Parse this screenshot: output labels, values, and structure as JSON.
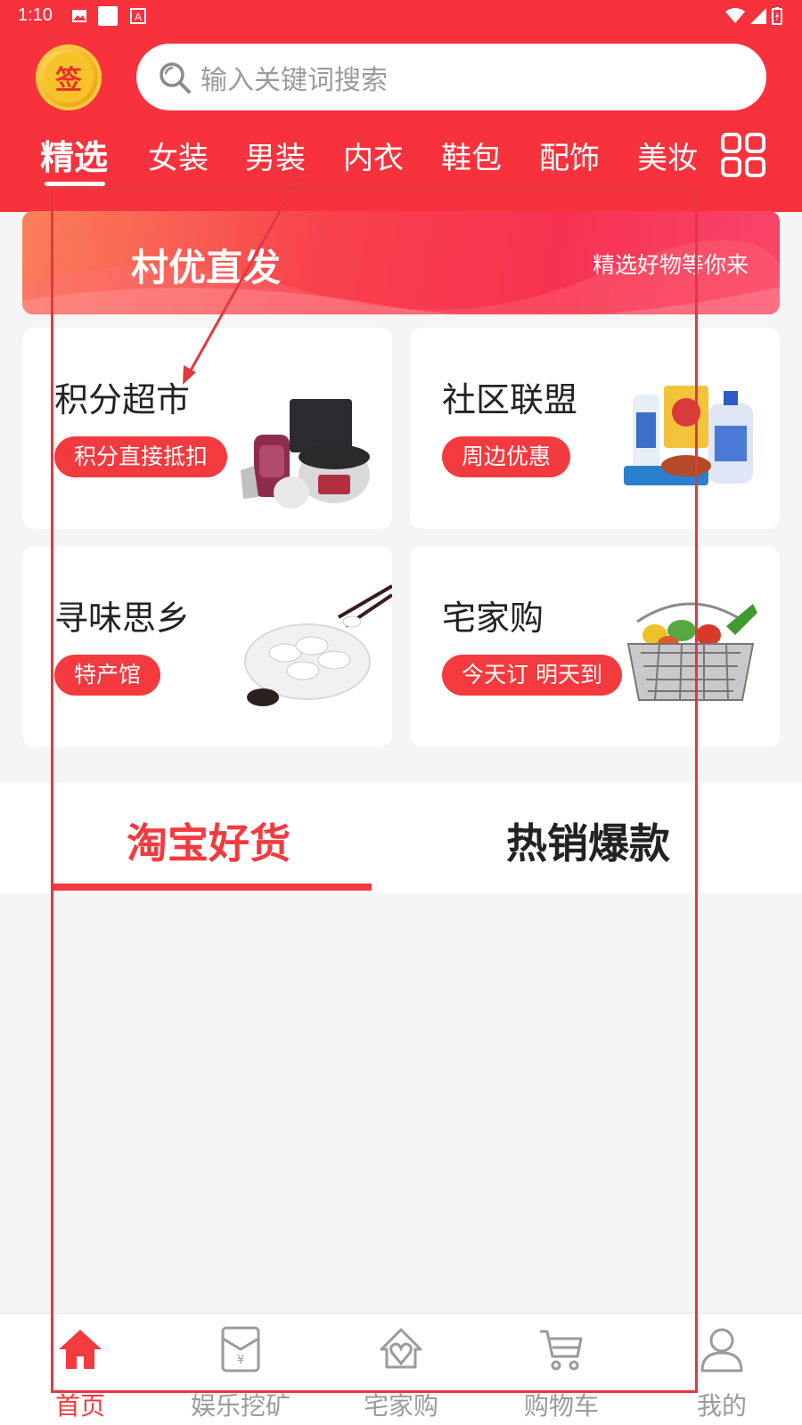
{
  "status_bar": {
    "time": "1:10"
  },
  "header": {
    "sign_label": "签",
    "search_placeholder": "输入关键词搜索",
    "categories": [
      "精选",
      "女装",
      "男装",
      "内衣",
      "鞋包",
      "配饰",
      "美妆"
    ]
  },
  "banner": {
    "title": "村优直发",
    "subtitle": "精选好物等你来"
  },
  "cards": [
    {
      "title": "积分超市",
      "tag": "积分直接抵扣",
      "image": "appliances-image"
    },
    {
      "title": "社区联盟",
      "tag": "周边优惠",
      "image": "household-products-image"
    },
    {
      "title": "寻味思乡",
      "tag": "特产馆",
      "image": "dumplings-image"
    },
    {
      "title": "宅家购",
      "tag": "今天订 明天到",
      "image": "vegetable-basket-image"
    }
  ],
  "feed_tabs": [
    "淘宝好货",
    "热销爆款"
  ],
  "bottom_nav": [
    {
      "label": "首页",
      "icon": "home-icon"
    },
    {
      "label": "娱乐挖矿",
      "icon": "wallet-icon"
    },
    {
      "label": "宅家购",
      "icon": "house-heart-icon"
    },
    {
      "label": "购物车",
      "icon": "cart-icon"
    },
    {
      "label": "我的",
      "icon": "user-icon"
    }
  ],
  "colors": {
    "primary": "#f7323d",
    "accent": "#f23a3f",
    "gold": "#f8c22b"
  }
}
